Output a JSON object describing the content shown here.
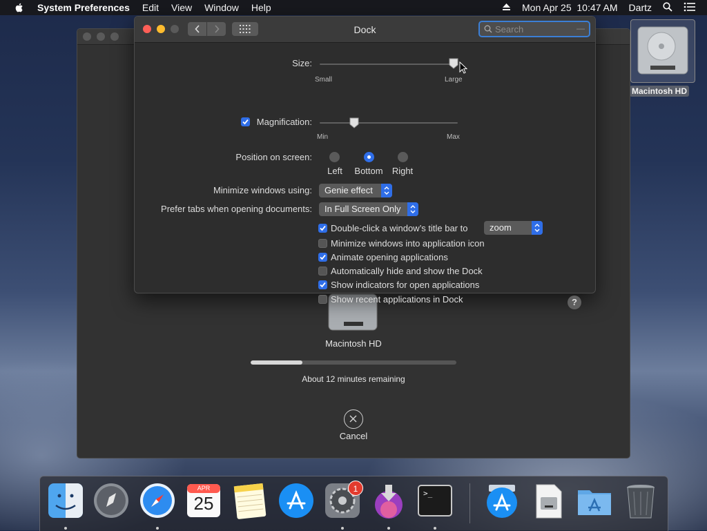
{
  "menubar": {
    "app_name": "System Preferences",
    "menus": [
      "Edit",
      "View",
      "Window",
      "Help"
    ],
    "datetime": "Mon Apr 25  10:47 AM",
    "user": "Dartz"
  },
  "desktop": {
    "disk_label": "Macintosh HD"
  },
  "installer": {
    "disk_label": "Macintosh HD",
    "progress": 0.25,
    "remaining": "About 12 minutes remaining",
    "cancel_label": "Cancel"
  },
  "window": {
    "title": "Dock",
    "search_placeholder": "Search"
  },
  "size": {
    "label": "Size:",
    "min_label": "Small",
    "max_label": "Large",
    "value": 0.97
  },
  "magnification": {
    "label": "Magnification:",
    "enabled": true,
    "min_label": "Min",
    "max_label": "Max",
    "value": 0.25
  },
  "position": {
    "label": "Position on screen:",
    "options": [
      "Left",
      "Bottom",
      "Right"
    ],
    "selected": "Bottom"
  },
  "minimize": {
    "label": "Minimize windows using:",
    "value": "Genie effect"
  },
  "prefer_tabs": {
    "label": "Prefer tabs when opening documents:",
    "value": "In Full Screen Only"
  },
  "options": [
    {
      "label": "Double-click a window’s title bar to",
      "checked": true
    },
    {
      "label": "Minimize windows into application icon",
      "checked": false
    },
    {
      "label": "Animate opening applications",
      "checked": true
    },
    {
      "label": "Automatically hide and show the Dock",
      "checked": false
    },
    {
      "label": "Show indicators for open applications",
      "checked": true
    },
    {
      "label": "Show recent applications in Dock",
      "checked": false
    }
  ],
  "double_click_action": "zoom",
  "help_label": "?",
  "dock": {
    "calendar_month": "APR",
    "calendar_day": "25",
    "prefs_badge": "1",
    "terminal_prompt": ">_"
  },
  "colors": {
    "accent": "#2f6ee8",
    "window_bg": "#2d2d2d",
    "badge": "#e23b2e"
  }
}
